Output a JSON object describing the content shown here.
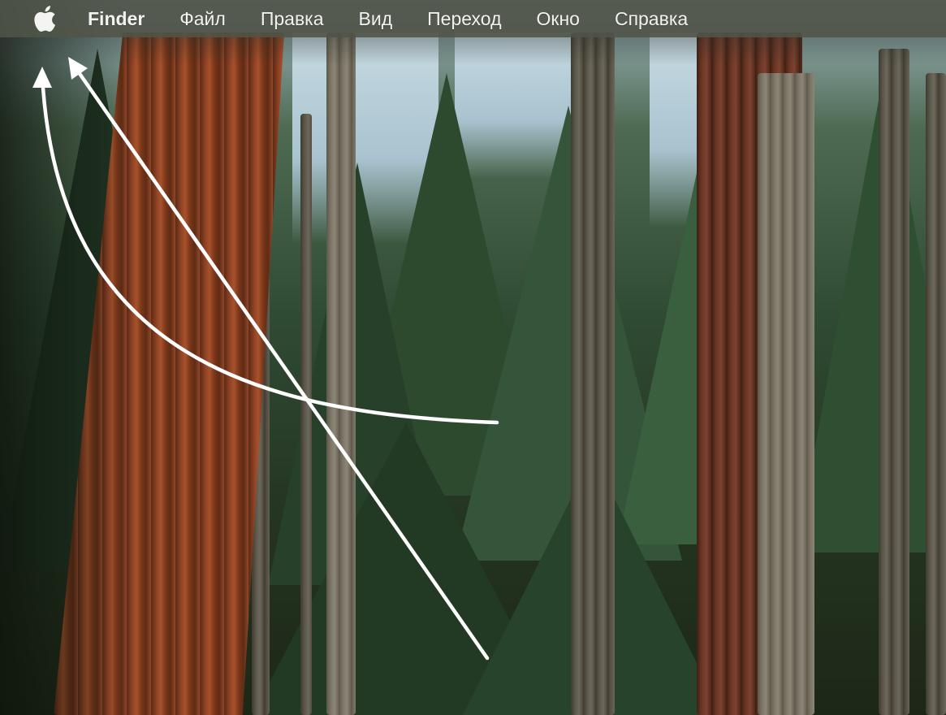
{
  "menubar": {
    "apple_icon": "apple-logo-icon",
    "app_name": "Finder",
    "items": [
      {
        "label": "Файл"
      },
      {
        "label": "Правка"
      },
      {
        "label": "Вид"
      },
      {
        "label": "Переход"
      },
      {
        "label": "Окно"
      },
      {
        "label": "Справка"
      }
    ]
  },
  "desktop": {
    "wallpaper": "sequoia-forest"
  },
  "annotations": {
    "arrow_color": "#ffffff",
    "arrows": [
      "curved-arrow-to-apple-menu",
      "straight-arrow-to-apple-menu"
    ]
  }
}
